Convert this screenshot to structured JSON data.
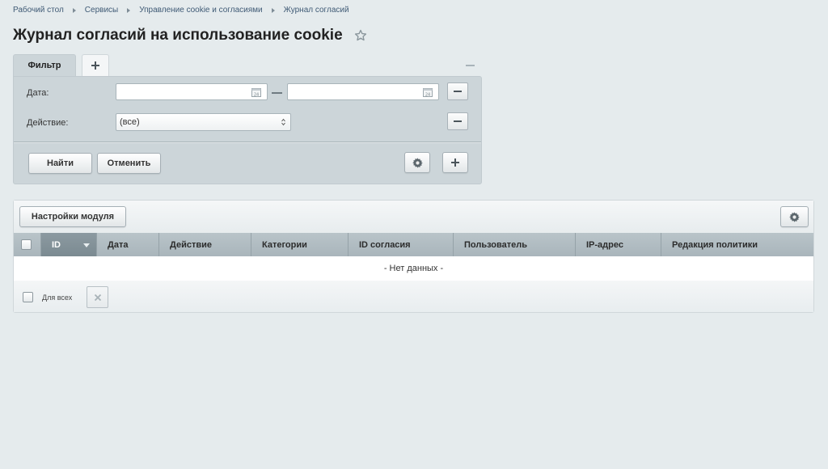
{
  "breadcrumb": {
    "items": [
      "Рабочий стол",
      "Сервисы",
      "Управление cookie и согласиями",
      "Журнал согласий"
    ]
  },
  "page": {
    "title": "Журнал согласий на использование cookie",
    "favorite_icon": "star-outline-icon"
  },
  "filter": {
    "tab_label": "Фильтр",
    "add_tab_icon": "plus-icon",
    "collapse_icon": "minus-icon",
    "date_label": "Дата:",
    "date_from_value": "",
    "date_to_value": "",
    "calendar_icon": "calendar-icon",
    "action_label": "Действие:",
    "action_value": "(все)",
    "find_button": "Найти",
    "cancel_button": "Отменить",
    "settings_icon": "gear-icon",
    "add_field_icon": "plus-icon"
  },
  "grid": {
    "settings_button": "Настройки модуля",
    "settings_icon": "gear-icon",
    "columns": [
      "ID",
      "Дата",
      "Действие",
      "Категории",
      "ID согласия",
      "Пользователь",
      "IP-адрес",
      "Редакция политики"
    ],
    "sorted_column": "ID",
    "empty_text": "- Нет данных -",
    "for_all_label": "Для всех",
    "delete_icon": "close-icon"
  },
  "colors": {
    "background": "#e5ebed",
    "filter_panel": "#ccd5d9",
    "header": "#b1bdc2",
    "sorted_header": "#84929a"
  }
}
